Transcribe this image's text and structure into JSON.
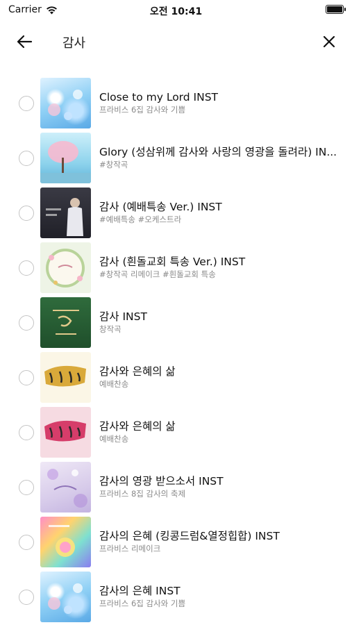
{
  "status_bar": {
    "carrier": "Carrier",
    "time": "오전 10:41"
  },
  "header": {
    "title": "감사"
  },
  "items": [
    {
      "title": "Close to my Lord INST",
      "subtitle": "프라비스 6집 감사와 기쁨",
      "thumb_style": "blue-flowers"
    },
    {
      "title": "Glory (성삼위께 감사와 사랑의 영광을 돌려라) IN...",
      "subtitle": "#창작곡",
      "thumb_style": "pink-tree"
    },
    {
      "title": "감사 (예배특송 Ver.) INST",
      "subtitle": "#예배특송 #오케스트라",
      "thumb_style": "dark-singer"
    },
    {
      "title": "감사 (흰돌교회 특송 Ver.) INST",
      "subtitle": "#창작곡 리메이크 #흰돌교회 특송",
      "thumb_style": "floral-wreath"
    },
    {
      "title": "감사 INST",
      "subtitle": "창작곡",
      "thumb_style": "green-calligraphy"
    },
    {
      "title": "감사와 은혜의 삶",
      "subtitle": "예배찬송",
      "thumb_style": "gold-brush"
    },
    {
      "title": "감사와 은혜의 삶",
      "subtitle": "예배찬송",
      "thumb_style": "pink-brush"
    },
    {
      "title": "감사의 영광 받으소서 INST",
      "subtitle": "프라비스 8집 감사의 축제",
      "thumb_style": "lavender-floral"
    },
    {
      "title": "감사의 은혜 (킹콩드럼&열정힙합) INST",
      "subtitle": "프라비스 리메이크",
      "thumb_style": "rainbow"
    },
    {
      "title": "감사의 은혜 INST",
      "subtitle": "프라비스 6집 감사와 기쁨",
      "thumb_style": "blue-flowers"
    }
  ]
}
